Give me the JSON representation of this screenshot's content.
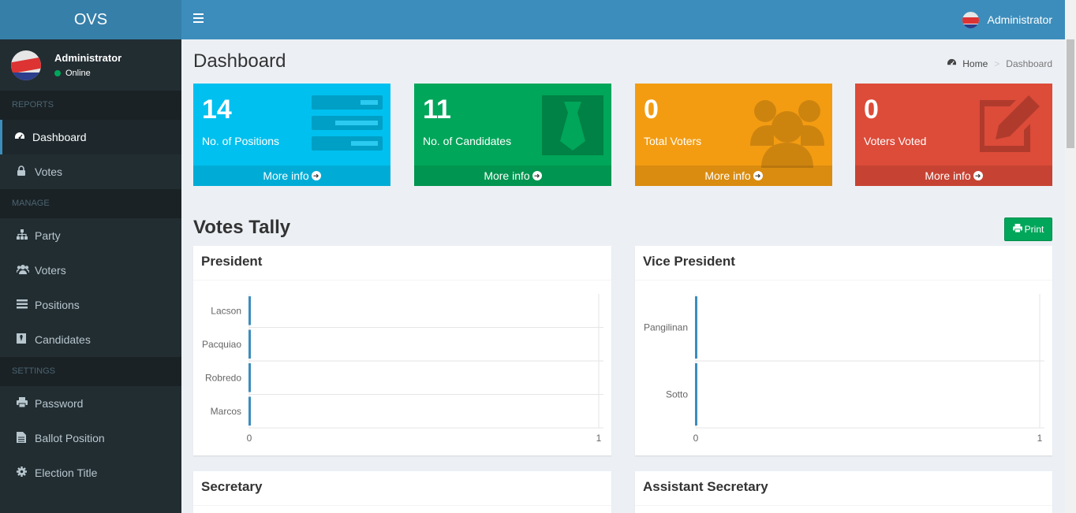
{
  "app": {
    "logo": "OVS"
  },
  "user": {
    "name": "Administrator",
    "status": "Online"
  },
  "sidebar": {
    "sections": [
      {
        "header": "REPORTS",
        "items": [
          {
            "label": "Dashboard",
            "icon": "dashboard-icon",
            "active": true
          },
          {
            "label": "Votes",
            "icon": "lock-icon"
          }
        ]
      },
      {
        "header": "MANAGE",
        "items": [
          {
            "label": "Party",
            "icon": "sitemap-icon"
          },
          {
            "label": "Voters",
            "icon": "users-icon"
          },
          {
            "label": "Positions",
            "icon": "list-icon"
          },
          {
            "label": "Candidates",
            "icon": "candidate-icon"
          }
        ]
      },
      {
        "header": "SETTINGS",
        "items": [
          {
            "label": "Password",
            "icon": "printer-icon"
          },
          {
            "label": "Ballot Position",
            "icon": "file-icon"
          },
          {
            "label": "Election Title",
            "icon": "gear-icon"
          }
        ]
      }
    ]
  },
  "header": {
    "title": "Dashboard",
    "breadcrumb": {
      "home": "Home",
      "current": "Dashboard"
    }
  },
  "stats": [
    {
      "value": "14",
      "label": "No. of Positions",
      "more": "More info",
      "color": "#00c0ef",
      "icon": "list-icon"
    },
    {
      "value": "11",
      "label": "No. of Candidates",
      "more": "More info",
      "color": "#00a65a",
      "icon": "tie-icon"
    },
    {
      "value": "0",
      "label": "Total Voters",
      "more": "More info",
      "color": "#f39c12",
      "icon": "users-icon"
    },
    {
      "value": "0",
      "label": "Voters Voted",
      "more": "More info",
      "color": "#dd4b39",
      "icon": "edit-icon"
    }
  ],
  "tally": {
    "title": "Votes Tally",
    "print_label": "Print"
  },
  "chart_data": [
    {
      "type": "bar",
      "orientation": "horizontal",
      "title": "President",
      "categories": [
        "Lacson",
        "Pacquiao",
        "Robredo",
        "Marcos"
      ],
      "values": [
        0,
        0,
        0,
        0
      ],
      "xlim": [
        0,
        1
      ],
      "xticks": [
        "0",
        "1"
      ],
      "bar_color": "#3c8dbc"
    },
    {
      "type": "bar",
      "orientation": "horizontal",
      "title": "Vice President",
      "categories": [
        "Pangilinan",
        "Sotto"
      ],
      "values": [
        0,
        0
      ],
      "xlim": [
        0,
        1
      ],
      "xticks": [
        "0",
        "1"
      ],
      "bar_color": "#3c8dbc"
    },
    {
      "type": "bar",
      "orientation": "horizontal",
      "title": "Secretary",
      "categories": [],
      "values": []
    },
    {
      "type": "bar",
      "orientation": "horizontal",
      "title": "Assistant Secretary",
      "categories": [],
      "values": []
    }
  ]
}
